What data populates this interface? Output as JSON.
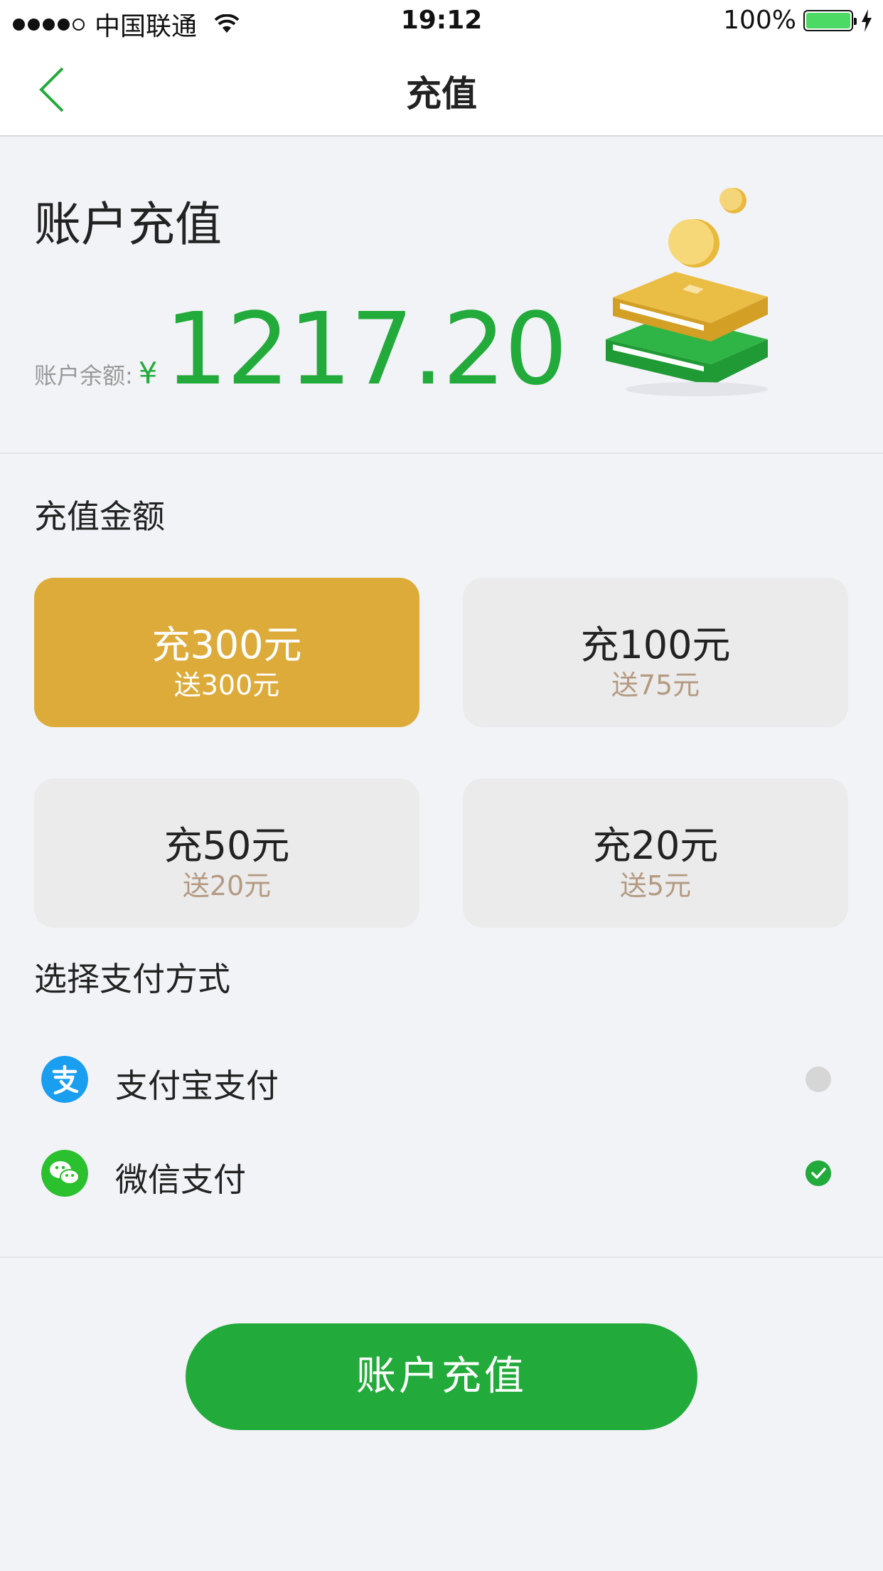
{
  "status_bar": {
    "carrier": "中国联通",
    "time": "19:12",
    "battery": "100%"
  },
  "nav": {
    "title": "充值"
  },
  "account": {
    "title": "账户充值",
    "balance_label": "账户余额:",
    "currency_symbol": "¥",
    "balance": "1217.20"
  },
  "amount_section": {
    "title": "充值金额",
    "options": [
      {
        "main": "充300元",
        "bonus": "送300元",
        "selected": true
      },
      {
        "main": "充100元",
        "bonus": "送75元",
        "selected": false
      },
      {
        "main": "充50元",
        "bonus": "送20元",
        "selected": false
      },
      {
        "main": "充20元",
        "bonus": "送5元",
        "selected": false
      }
    ]
  },
  "payment_section": {
    "title": "选择支付方式",
    "methods": [
      {
        "label": "支付宝支付",
        "icon": "alipay-icon",
        "checked": false
      },
      {
        "label": "微信支付",
        "icon": "wechat-icon",
        "checked": true
      }
    ]
  },
  "submit": {
    "label": "账户充值"
  },
  "colors": {
    "brand_green": "#22ab3a",
    "selected_gold": "#ddab3a",
    "alipay_blue": "#1a9ef0",
    "wechat_green": "#2bc02d"
  }
}
